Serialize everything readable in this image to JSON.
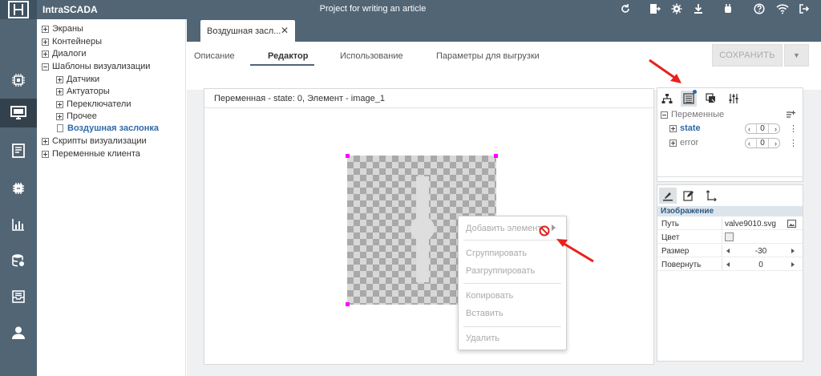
{
  "app": {
    "title": "IntraSCADA",
    "project": "Project for writing an article"
  },
  "topbar_icons": [
    "refresh-icon",
    "export-icon",
    "gear-icon",
    "download-icon",
    "plugin-icon",
    "help-icon",
    "wifi-icon",
    "logout-icon"
  ],
  "rail": [
    "processor-icon",
    "monitor-icon",
    "document-icon",
    "chip-icon",
    "bar-chart-icon",
    "database-icon",
    "archive-icon",
    "user-icon"
  ],
  "tree": {
    "items": [
      {
        "label": "Экраны"
      },
      {
        "label": "Контейнеры"
      },
      {
        "label": "Диалоги"
      },
      {
        "label": "Шаблоны визуализации"
      },
      {
        "label": "Датчики"
      },
      {
        "label": "Актуаторы"
      },
      {
        "label": "Переключатели"
      },
      {
        "label": "Прочее"
      },
      {
        "label": "Воздушная заслонка"
      },
      {
        "label": "Скрипты визуализации"
      },
      {
        "label": "Переменные клиента"
      }
    ]
  },
  "doc_tab": {
    "label": "Воздушная засл...",
    "close": "✕"
  },
  "subtabs": [
    "Описание",
    "Редактор",
    "Использование",
    "Параметры для выгрузки"
  ],
  "save": {
    "label": "СОХРАНИТЬ"
  },
  "editor": {
    "title": "Переменная - state: 0, Элемент - image_1"
  },
  "context_menu": {
    "items": [
      "Добавить элемент",
      "Сгруппировать",
      "Разгруппировать",
      "Копировать",
      "Вставить",
      "Удалить"
    ]
  },
  "variables": {
    "header": "Переменные",
    "rows": [
      {
        "name": "state",
        "value": "0"
      },
      {
        "name": "error",
        "value": "0"
      }
    ]
  },
  "properties": {
    "group": "Изображение",
    "rows": [
      {
        "key": "Путь",
        "value": "valve9010.svg"
      },
      {
        "key": "Цвет",
        "value": ""
      },
      {
        "key": "Размер",
        "value": "-30"
      },
      {
        "key": "Повернуть",
        "value": "0"
      }
    ]
  },
  "colors": {
    "header": "#516575",
    "accent": "#2e6aa8",
    "handle": "#ff00ff",
    "arrow": "#e8211d"
  }
}
